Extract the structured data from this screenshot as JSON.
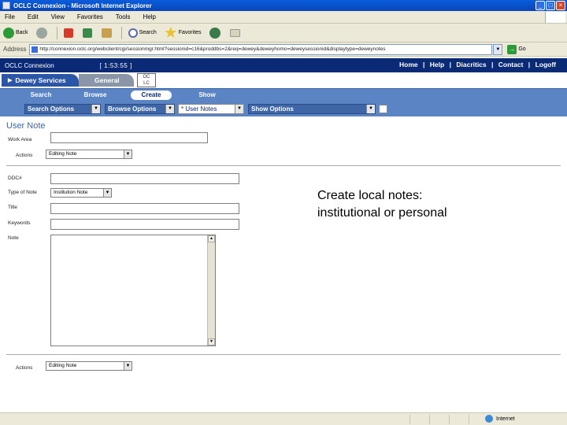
{
  "window": {
    "title": "OCLC Connexion - Microsoft Internet Explorer",
    "controls": [
      "_",
      "□",
      "×"
    ]
  },
  "menubar": {
    "items": [
      "File",
      "Edit",
      "View",
      "Favorites",
      "Tools",
      "Help"
    ]
  },
  "toolbar": {
    "back_label": "Back",
    "search_label": "Search",
    "favorites_label": "Favorites"
  },
  "address": {
    "label": "Address",
    "url": "http://connexion.oclc.org/webclient/cgi/sessionmgr.html?sessionid=c16&proddbs=2&req=dewey&deweyhomo=deweysessionid&displaytype=deweynotes",
    "go_label": "Go"
  },
  "oclc_header": {
    "app_name": "OCLC Connexion",
    "clock": "[ 1:53:55 ]",
    "links": [
      "Home",
      "Help",
      "Diacritics",
      "Contact",
      "Logoff"
    ],
    "separator": "|"
  },
  "service_tabs": [
    {
      "label": "Dewey Services"
    },
    {
      "label": "General"
    }
  ],
  "oclc_logo": {
    "line1": "OC",
    "line2": "LC"
  },
  "nav": {
    "search": "Search",
    "browse": "Browse",
    "create": "Create",
    "show": "Show"
  },
  "options": {
    "search_options": "Search Options",
    "browse_options": "Browse Options",
    "user_notes": "* User Notes",
    "show_options": "Show Options"
  },
  "form": {
    "title": "User Note",
    "work_area_label": "Work Area",
    "actions_label": "Actions",
    "actions_value": "Editing Note",
    "ddc_label": "DDC#",
    "type_label": "Type of Note",
    "type_value": "Institution Note",
    "title_label": "Title",
    "keywords_label": "Keywords",
    "note_label": "Note",
    "actions_bottom_label": "Actions",
    "actions_bottom_value": "Editing Note"
  },
  "callout": {
    "line1": "Create local notes:",
    "line2": "institutional or personal"
  },
  "status": {
    "zone": "Internet"
  }
}
